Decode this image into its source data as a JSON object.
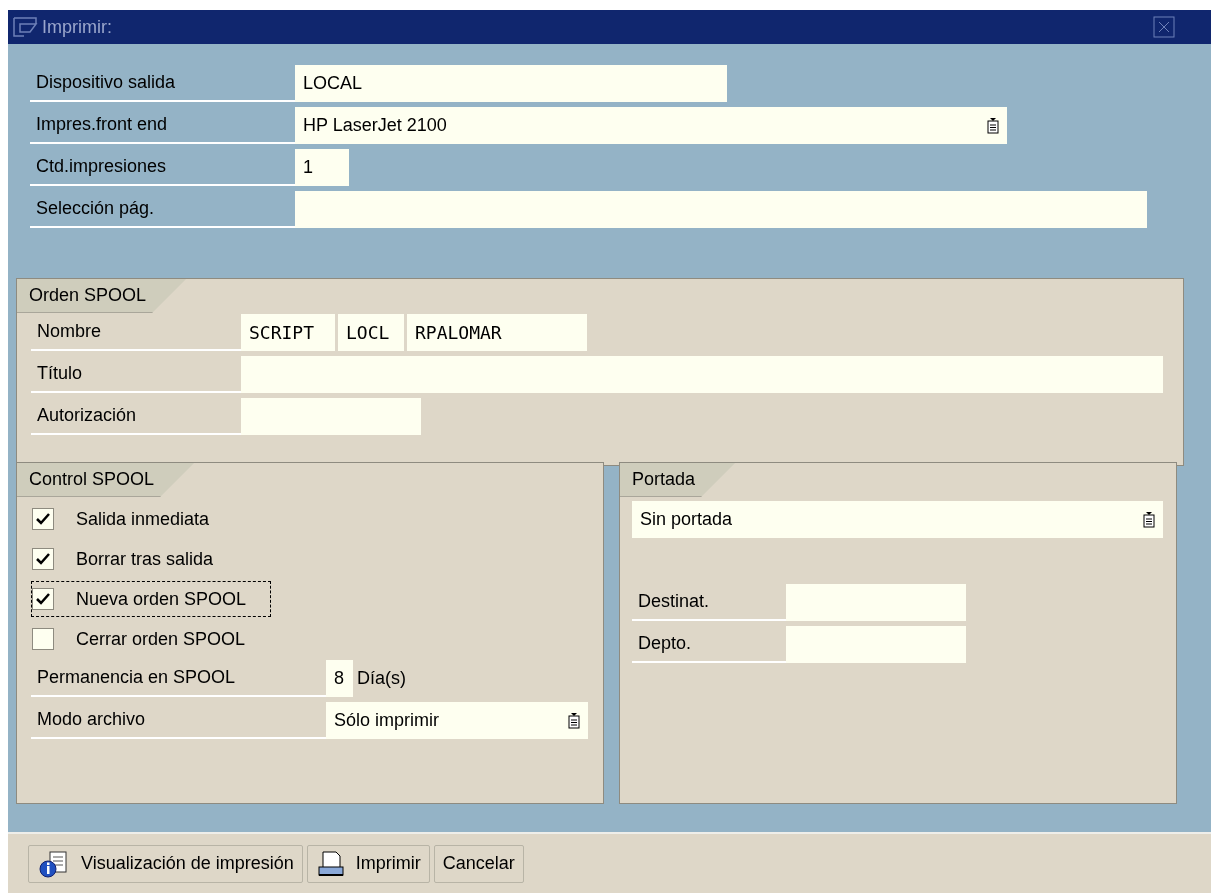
{
  "window": {
    "title": "Imprimir:"
  },
  "fields": [
    {
      "label": "Dispositivo salida",
      "value": "LOCAL",
      "kind": "text"
    },
    {
      "label": "Impres.front end",
      "value": "HP LaserJet 2100",
      "kind": "dropdown"
    },
    {
      "label": "Ctd.impresiones",
      "value": "1",
      "kind": "text"
    },
    {
      "label": "Selección pág.",
      "kind": "text"
    }
  ],
  "orden_spool": {
    "title": "Orden SPOOL",
    "nombre": {
      "label": "Nombre",
      "parts": [
        "SCRIPT",
        "LOCL",
        "RPALOMAR"
      ]
    },
    "fields": [
      {
        "label": "Título"
      },
      {
        "label": "Autorización"
      }
    ]
  },
  "control_spool": {
    "title": "Control SPOOL",
    "checkboxes": [
      {
        "label": "Salida inmediata",
        "checked": true,
        "focused": false
      },
      {
        "label": "Borrar tras salida",
        "checked": true,
        "focused": false
      },
      {
        "label": "Nueva orden SPOOL",
        "checked": true,
        "focused": true
      },
      {
        "label": "Cerrar orden SPOOL",
        "checked": false,
        "focused": false
      }
    ],
    "retention": {
      "label": "Permanencia en SPOOL",
      "value": "8",
      "unit": "Día(s)"
    },
    "archive_mode": {
      "label": "Modo archivo",
      "value": "Sólo imprimir"
    }
  },
  "portada": {
    "title": "Portada",
    "value": "Sin portada",
    "fields": [
      {
        "label": "Destinat."
      },
      {
        "label": "Depto."
      }
    ]
  },
  "buttons": [
    {
      "label": "Visualización de impresión",
      "kind": "preview"
    },
    {
      "label": "Imprimir",
      "kind": "print"
    },
    {
      "label": "Cancelar",
      "kind": "plain"
    }
  ]
}
